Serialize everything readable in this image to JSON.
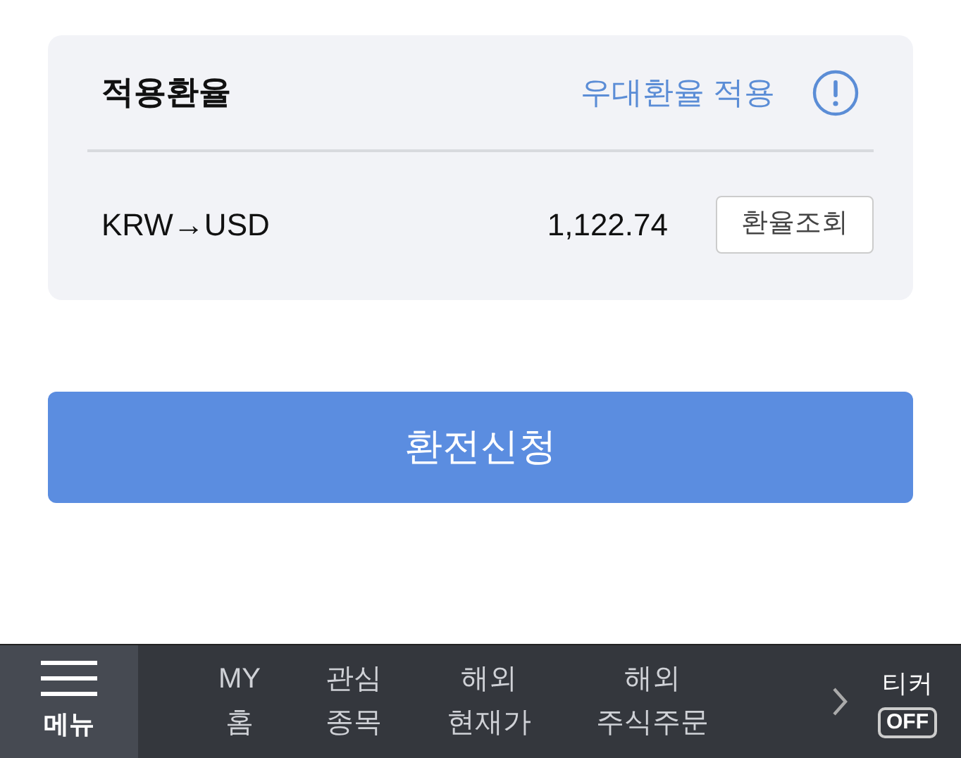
{
  "rate_card": {
    "title": "적용환율",
    "preferential_link": "우대환율 적용",
    "pair": "KRW→USD",
    "rate": "1,122.74",
    "lookup_button": "환율조회"
  },
  "submit_button": "환전신청",
  "bottom_bar": {
    "menu_label": "메뉴",
    "items": [
      {
        "lines": [
          "MY",
          "홈"
        ]
      },
      {
        "lines": [
          "관심",
          "종목"
        ]
      },
      {
        "lines": [
          "해외",
          "현재가"
        ]
      },
      {
        "lines": [
          "해외",
          "주식주문"
        ]
      }
    ],
    "ticker": {
      "label": "티커",
      "state_text": "OFF",
      "on": false
    }
  }
}
